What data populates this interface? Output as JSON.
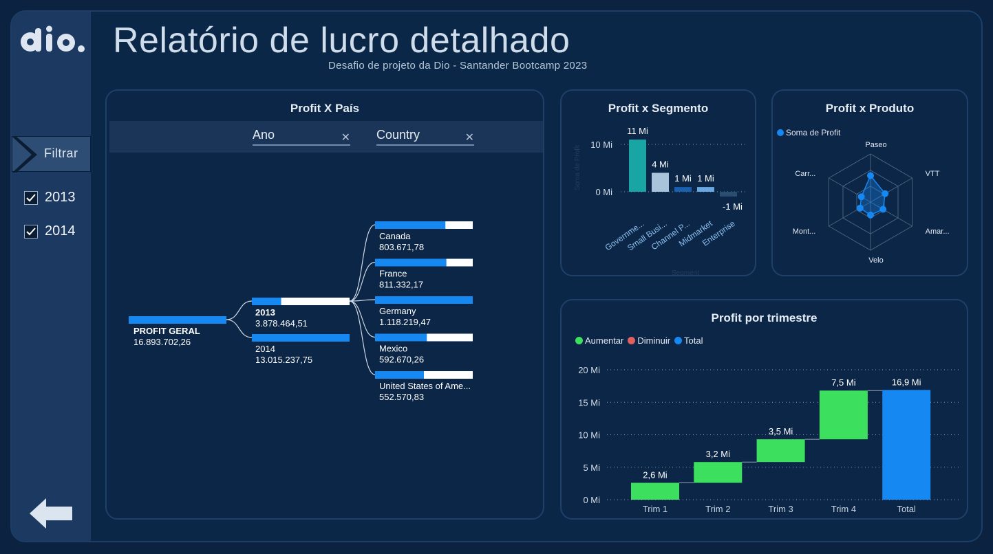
{
  "header": {
    "title": "Relatório de lucro detalhado",
    "subtitle": "Desafio de projeto da Dio - Santander Bootcamp 2023"
  },
  "sidebar": {
    "filter_label": "Filtrar",
    "years": [
      {
        "label": "2013",
        "checked": true
      },
      {
        "label": "2014",
        "checked": true
      }
    ]
  },
  "colors": {
    "blue": "#1688f2",
    "green": "#3ce05e",
    "red": "#e06060",
    "teal": "#1aa5a5"
  },
  "chart_data": [
    {
      "type": "decomposition-tree",
      "title": "Profit X País",
      "slicers": [
        "Ano",
        "Country"
      ],
      "root": {
        "label": "PROFIT GERAL",
        "value": "16.893.702,26",
        "fill": 1.0
      },
      "level1": [
        {
          "label": "2013",
          "value": "3.878.464,51",
          "fill": 0.3,
          "expanded": true
        },
        {
          "label": "2014",
          "value": "13.015.237,75",
          "fill": 1.0,
          "expanded": false
        }
      ],
      "level2": [
        {
          "label": "Canada",
          "value": "803.671,78",
          "fill": 0.72
        },
        {
          "label": "France",
          "value": "811.332,17",
          "fill": 0.73
        },
        {
          "label": "Germany",
          "value": "1.118.219,47",
          "fill": 1.0
        },
        {
          "label": "Mexico",
          "value": "592.670,26",
          "fill": 0.53
        },
        {
          "label": "United States of Ame...",
          "value": "552.570,83",
          "fill": 0.5
        }
      ]
    },
    {
      "type": "bar",
      "title": "Profit x Segmento",
      "categories": [
        "Governme...",
        "Small Busi...",
        "Channel P...",
        "Midmarket",
        "Enterprise"
      ],
      "values": [
        11,
        4,
        1,
        1,
        -1
      ],
      "data_labels": [
        "11 Mi",
        "4 Mi",
        "1 Mi",
        "1 Mi",
        "-1 Mi"
      ],
      "bar_colors": [
        "#1aa5a5",
        "#a9c4da",
        "#1a5fb0",
        "#6aa9e0",
        "#2a4d70"
      ],
      "yticks": [
        "10 Mi",
        "0 Mi"
      ],
      "ylim": [
        -1,
        13
      ],
      "ylabel": "Soma de Profit",
      "xlabel": "Segment"
    },
    {
      "type": "radar",
      "title": "Profit x Produto",
      "legend": "Soma de Profit",
      "axes": [
        "Paseo",
        "VTT",
        "Amar...",
        "Velo",
        "Mont...",
        "Carr..."
      ],
      "values": [
        0.55,
        0.35,
        0.3,
        0.27,
        0.25,
        0.22
      ]
    },
    {
      "type": "waterfall",
      "title": "Profit por trimestre",
      "legend": [
        {
          "label": "Aumentar",
          "color": "#3ce05e"
        },
        {
          "label": "Diminuir",
          "color": "#e06060"
        },
        {
          "label": "Total",
          "color": "#1688f2"
        }
      ],
      "categories": [
        "Trim 1",
        "Trim 2",
        "Trim 3",
        "Trim 4",
        "Total"
      ],
      "values": [
        2.6,
        3.2,
        3.5,
        7.5,
        16.9
      ],
      "data_labels": [
        "2,6 Mi",
        "3,2 Mi",
        "3,5 Mi",
        "7,5 Mi",
        "16,9 Mi"
      ],
      "yticks": [
        {
          "v": 20,
          "label": "20 Mi"
        },
        {
          "v": 15,
          "label": "15 Mi"
        },
        {
          "v": 10,
          "label": "10 Mi"
        },
        {
          "v": 5,
          "label": "5 Mi"
        },
        {
          "v": 0,
          "label": "0 Mi"
        }
      ],
      "ylim": [
        0,
        20
      ]
    }
  ]
}
